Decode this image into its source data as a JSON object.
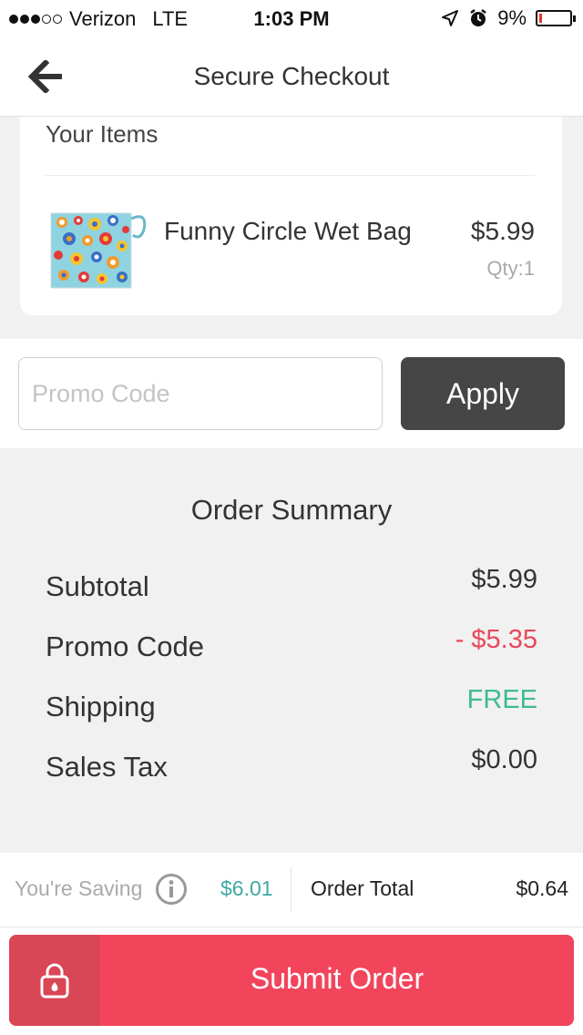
{
  "status_bar": {
    "carrier": "Verizon",
    "network": "LTE",
    "time": "1:03 PM",
    "battery": "9%",
    "battery_level": 0.09,
    "signal_bars_filled": 3,
    "signal_bars_total": 5
  },
  "nav": {
    "title": "Secure Checkout",
    "back_icon": "arrow-left-icon"
  },
  "items": {
    "heading": "Your Items",
    "list": [
      {
        "name": "Funny Circle Wet Bag",
        "price": "$5.99",
        "qty": "Qty:1"
      }
    ]
  },
  "promo": {
    "placeholder": "Promo Code",
    "value": "",
    "apply_label": "Apply"
  },
  "summary": {
    "title": "Order Summary",
    "rows": [
      {
        "label": "Subtotal",
        "value": "$5.99"
      },
      {
        "label": "Promo Code",
        "value": "- $5.35"
      },
      {
        "label": "Shipping",
        "value": "FREE"
      },
      {
        "label": "Sales Tax",
        "value": "$0.00"
      }
    ]
  },
  "totals": {
    "saving_label": "You're Saving",
    "saving_value": "$6.01",
    "order_total_label": "Order Total",
    "order_total_value": "$0.64"
  },
  "submit": {
    "label": "Submit Order",
    "icon": "lock-icon"
  },
  "colors": {
    "accent": "#f2455c",
    "lock_zone": "#d94656",
    "discount": "#e8485b",
    "free": "#3fba94",
    "saving": "#3fa8a4",
    "apply_button": "#464646",
    "background": "#f0f1f0"
  }
}
